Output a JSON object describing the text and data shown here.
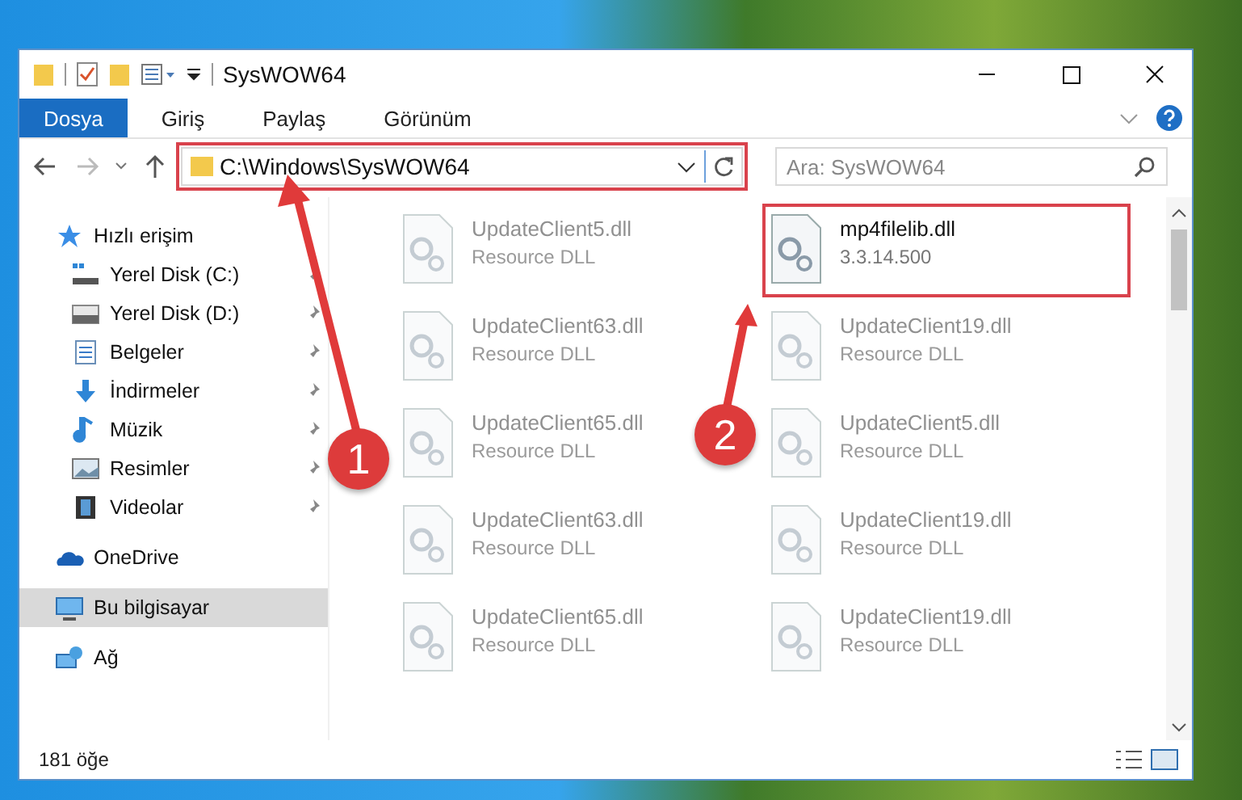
{
  "window": {
    "title": "SysWOW64"
  },
  "ribbon_tabs": [
    {
      "label": "Dosya",
      "selected": true
    },
    {
      "label": "Giriş",
      "selected": false
    },
    {
      "label": "Paylaş",
      "selected": false
    },
    {
      "label": "Görünüm",
      "selected": false
    }
  ],
  "address_bar": {
    "path": "C:\\Windows\\SysWOW64",
    "highlighted": true
  },
  "search": {
    "placeholder": "Ara: SysWOW64"
  },
  "sidebar": {
    "items": [
      {
        "label": "Hızlı erişim",
        "kind": "star",
        "selected": false,
        "children": [
          {
            "label": "Yerel Disk (C:)",
            "kind": "system-drive",
            "pinned": true
          },
          {
            "label": "Yerel Disk (D:)",
            "kind": "drive",
            "pinned": true
          },
          {
            "label": "Belgeler",
            "kind": "document",
            "pinned": true
          },
          {
            "label": "İndirmeler",
            "kind": "download",
            "pinned": true
          },
          {
            "label": "Müzik",
            "kind": "music",
            "pinned": true
          },
          {
            "label": "Resimler",
            "kind": "pictures",
            "pinned": true
          },
          {
            "label": "Videolar",
            "kind": "videos",
            "pinned": true
          }
        ]
      },
      {
        "label": "OneDrive",
        "kind": "cloud",
        "selected": false
      },
      {
        "label": "Bu bilgisayar",
        "kind": "computer",
        "selected": true
      },
      {
        "label": "Ağ",
        "kind": "network",
        "selected": false
      }
    ]
  },
  "files": [
    {
      "name": "UpdateClient5.dll",
      "detail": "Resource DLL",
      "faded": true,
      "highlighted": false
    },
    {
      "name": "mp4filelib.dll",
      "detail": "3.3.14.500",
      "faded": false,
      "highlighted": true
    },
    {
      "name": "UpdateClient63.dll",
      "detail": "Resource DLL",
      "faded": true,
      "highlighted": false
    },
    {
      "name": "UpdateClient19.dll",
      "detail": "Resource DLL",
      "faded": true,
      "highlighted": false
    },
    {
      "name": "UpdateClient65.dll",
      "detail": "Resource DLL",
      "faded": true,
      "highlighted": false
    },
    {
      "name": "UpdateClient5.dll",
      "detail": "Resource DLL",
      "faded": true,
      "highlighted": false
    },
    {
      "name": "UpdateClient63.dll",
      "detail": "Resource DLL",
      "faded": true,
      "highlighted": false
    },
    {
      "name": "UpdateClient19.dll",
      "detail": "Resource DLL",
      "faded": true,
      "highlighted": false
    },
    {
      "name": "UpdateClient65.dll",
      "detail": "Resource DLL",
      "faded": true,
      "highlighted": false
    },
    {
      "name": "UpdateClient19.dll",
      "detail": "Resource DLL",
      "faded": true,
      "highlighted": false
    }
  ],
  "status_bar": {
    "item_count": "181 öğe"
  },
  "annotations": [
    {
      "number": "1"
    },
    {
      "number": "2"
    }
  ]
}
